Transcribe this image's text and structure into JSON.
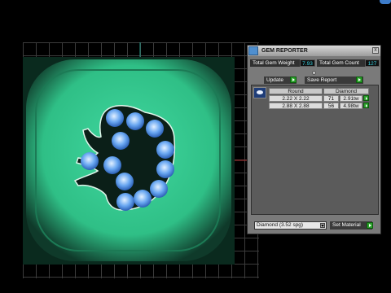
{
  "panel": {
    "title": "GEM REPORTER",
    "close_label": "x",
    "weight_label": "Total Gem Weight",
    "weight_value": "7.93",
    "count_label": "Total Gem Count",
    "count_value": "127",
    "update_label": "Update",
    "save_label": "Save Report",
    "table": {
      "headers": [
        "Round",
        "Diamond"
      ],
      "rows": [
        {
          "size": "2.22 X 2.22",
          "count": "71",
          "weight": "2.91tw"
        },
        {
          "size": "2.88 X 2.88",
          "count": "56",
          "weight": "4.98tw"
        }
      ]
    },
    "material_select": "Diamond    (3.52 spg)",
    "set_material_label": "Set Material"
  },
  "colors": {
    "gem_blue": "#4f8fe8",
    "model_green": "#35c88f",
    "value_cyan": "#39d4e3",
    "button_green": "#2aa02a"
  },
  "icons": [
    "gem-reporter-app-icon",
    "close-icon",
    "play-arrow-icon",
    "diamond-gem-icon",
    "dropdown-chevron-icon"
  ]
}
